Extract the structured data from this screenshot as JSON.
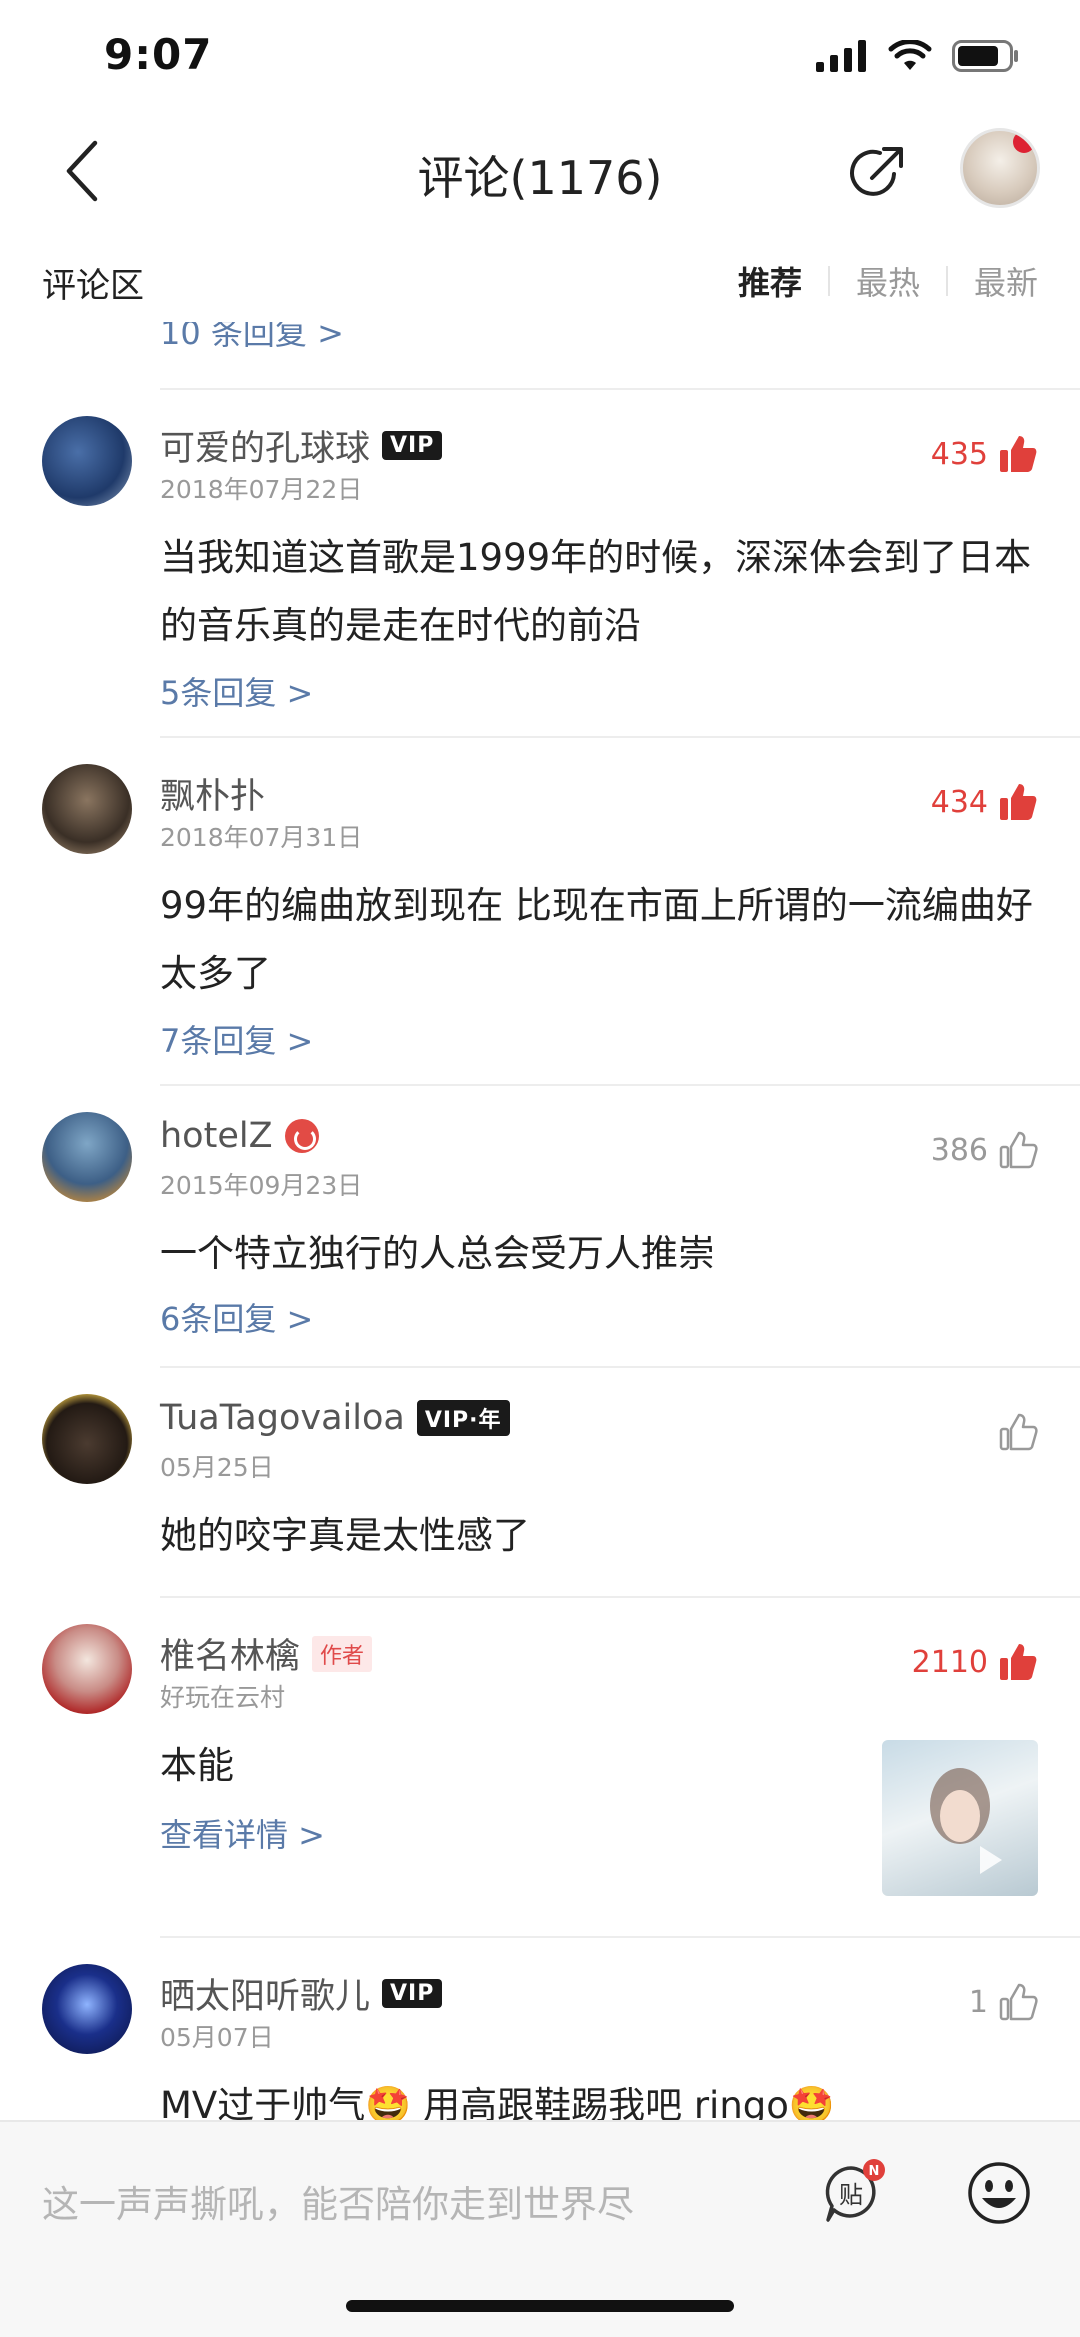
{
  "status_bar": {
    "time": "9:07"
  },
  "nav": {
    "title": "评论(1176)"
  },
  "section": {
    "title": "评论区",
    "sort_tabs": [
      "推荐",
      "最热",
      "最新"
    ]
  },
  "partial_top": {
    "replies": "10 条回复 >"
  },
  "comments": [
    {
      "username": "可爱的孔球球",
      "badge": "VIP",
      "date": "2018年07月22日",
      "likes": "435",
      "text": "当我知道这首歌是1999年的时候，深深体会到了日本的音乐真的是走在时代的前沿",
      "replies": "5条回复 >"
    },
    {
      "username": "飘朴扑",
      "date": "2018年07月31日",
      "likes": "434",
      "text": "99年的编曲放到现在 比现在市面上所谓的一流编曲好太多了",
      "replies": "7条回复 >"
    },
    {
      "username": "hotelZ",
      "date": "2015年09月23日",
      "likes": "386",
      "text": "一个特立独行的人总会受万人推崇",
      "replies": "6条回复 >"
    },
    {
      "username": "TuaTagovailoa",
      "badge": "VIP·年",
      "date": "05月25日",
      "likes": "",
      "text": "她的咬字真是太性感了"
    },
    {
      "username": "椎名林檎",
      "badge": "作者",
      "date": "好玩在云村",
      "likes": "2110",
      "text": "本能",
      "replies": "查看详情 >"
    },
    {
      "username": "晒太阳听歌儿",
      "badge": "VIP",
      "date": "05月07日",
      "likes": "1",
      "text": "MV过于帅气🤩 用高跟鞋踢我吧 ringo🤩"
    }
  ],
  "input_bar": {
    "placeholder": "这一声声撕吼，能否陪你走到世界尽",
    "tie_label": "贴",
    "notice": "N"
  },
  "colors": {
    "accent_red": "#e0403b",
    "link_blue": "#5a7aa8"
  }
}
